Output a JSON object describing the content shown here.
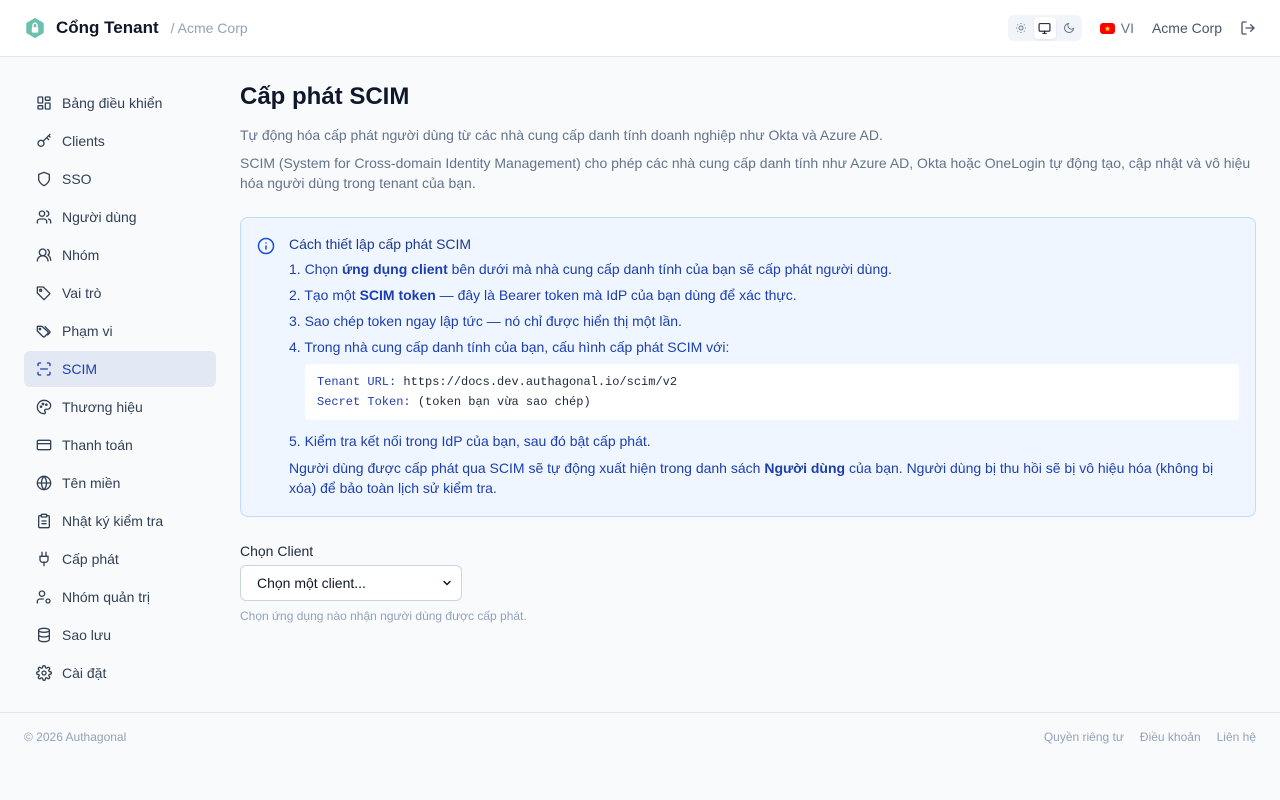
{
  "header": {
    "brand": "Cổng Tenant",
    "tenant": "/ Acme Corp",
    "language": "VI",
    "user": "Acme Corp"
  },
  "sidebar": {
    "items": [
      {
        "label": "Bảng điều khiển",
        "icon": "dashboard-icon"
      },
      {
        "label": "Clients",
        "icon": "key-icon"
      },
      {
        "label": "SSO",
        "icon": "shield-icon"
      },
      {
        "label": "Người dùng",
        "icon": "users-icon"
      },
      {
        "label": "Nhóm",
        "icon": "group-icon"
      },
      {
        "label": "Vai trò",
        "icon": "tag-icon"
      },
      {
        "label": "Phạm vi",
        "icon": "tags-icon"
      },
      {
        "label": "SCIM",
        "icon": "scan-icon"
      },
      {
        "label": "Thương hiệu",
        "icon": "palette-icon"
      },
      {
        "label": "Thanh toán",
        "icon": "credit-card-icon"
      },
      {
        "label": "Tên miền",
        "icon": "globe-icon"
      },
      {
        "label": "Nhật ký kiểm tra",
        "icon": "clipboard-icon"
      },
      {
        "label": "Cấp phát",
        "icon": "plug-icon"
      },
      {
        "label": "Nhóm quản trị",
        "icon": "user-cog-icon"
      },
      {
        "label": "Sao lưu",
        "icon": "database-icon"
      },
      {
        "label": "Cài đặt",
        "icon": "gear-icon"
      }
    ],
    "active": "SCIM"
  },
  "main": {
    "title": "Cấp phát SCIM",
    "subtitle": "Tự động hóa cấp phát người dùng từ các nhà cung cấp danh tính doanh nghiệp như Okta và Azure AD.",
    "description": "SCIM (System for Cross-domain Identity Management) cho phép các nhà cung cấp danh tính như Azure AD, Okta hoặc OneLogin tự động tạo, cập nhật và vô hiệu hóa người dùng trong tenant của bạn.",
    "info": {
      "title": "Cách thiết lập cấp phát SCIM",
      "step1_pre": "1. Chọn ",
      "step1_bold": "ứng dụng client",
      "step1_post": " bên dưới mà nhà cung cấp danh tính của bạn sẽ cấp phát người dùng.",
      "step2_pre": "2. Tạo một ",
      "step2_bold": "SCIM token",
      "step2_post": " — đây là Bearer token mà IdP của bạn dùng để xác thực.",
      "step3": "3. Sao chép token ngay lập tức — nó chỉ được hiển thị một lần.",
      "step4": "4. Trong nhà cung cấp danh tính của bạn, cấu hình cấp phát SCIM với:",
      "code_url_key": "Tenant URL:",
      "code_url_val": "https://docs.dev.authagonal.io/scim/v2",
      "code_token_key": "Secret Token:",
      "code_token_val": "(token bạn vừa sao chép)",
      "step5": "5. Kiểm tra kết nối trong IdP của bạn, sau đó bật cấp phát.",
      "note_pre": "Người dùng được cấp phát qua SCIM sẽ tự động xuất hiện trong danh sách ",
      "note_bold": "Người dùng",
      "note_post": " của bạn. Người dùng bị thu hồi sẽ bị vô hiệu hóa (không bị xóa) để bảo toàn lịch sử kiểm tra."
    },
    "client_field": {
      "label": "Chọn Client",
      "selected": "Chọn một client...",
      "help": "Chọn ứng dụng nào nhận người dùng được cấp phát."
    }
  },
  "footer": {
    "copyright": "© 2026 Authagonal",
    "privacy": "Quyền riêng tư",
    "terms": "Điều khoản",
    "contact": "Liên hệ"
  },
  "colors": {
    "accent": "#1e40af",
    "info_bg": "#eff6ff",
    "brand_logo": "#5eb8a8"
  }
}
